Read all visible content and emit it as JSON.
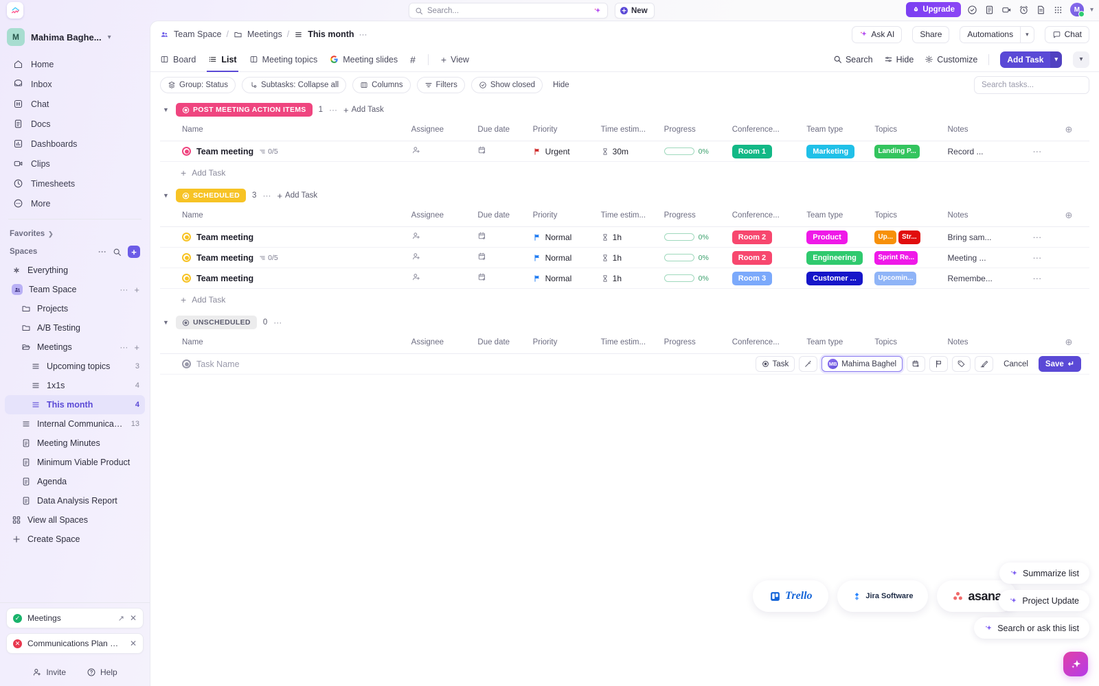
{
  "topbar": {
    "search_placeholder": "Search...",
    "new_label": "New",
    "upgrade_label": "Upgrade",
    "icons": [
      "check-circle-icon",
      "clipboard-icon",
      "video-clip-icon",
      "alarm-clock-icon",
      "doc-icon",
      "apps-grid-icon"
    ],
    "avatar_initial": "M"
  },
  "sidebar": {
    "workspace": {
      "initial": "M",
      "name": "Mahima Baghe..."
    },
    "nav": [
      {
        "label": "Home",
        "icon": "home-icon"
      },
      {
        "label": "Inbox",
        "icon": "inbox-icon"
      },
      {
        "label": "Chat",
        "icon": "chat-icon"
      },
      {
        "label": "Docs",
        "icon": "docs-icon"
      },
      {
        "label": "Dashboards",
        "icon": "dashboards-icon"
      },
      {
        "label": "Clips",
        "icon": "clips-icon"
      },
      {
        "label": "Timesheets",
        "icon": "timesheets-icon"
      },
      {
        "label": "More",
        "icon": "more-icon"
      }
    ],
    "favorites_label": "Favorites",
    "spaces_label": "Spaces",
    "tree": [
      {
        "label": "Everything",
        "count": "",
        "icon": "everything-icon",
        "indent": 0
      },
      {
        "label": "Team Space",
        "count": "",
        "icon": "team-space-icon",
        "indent": 0,
        "dots": true,
        "plus": true
      },
      {
        "label": "Projects",
        "count": "",
        "icon": "folder-icon",
        "indent": 1
      },
      {
        "label": "A/B Testing",
        "count": "",
        "icon": "folder-icon",
        "indent": 1
      },
      {
        "label": "Meetings",
        "count": "",
        "icon": "folder-open-icon",
        "indent": 1,
        "dots": true,
        "plus": true
      },
      {
        "label": "Upcoming topics",
        "count": "3",
        "icon": "list-icon",
        "indent": 2
      },
      {
        "label": "1x1s",
        "count": "4",
        "icon": "list-icon",
        "indent": 2
      },
      {
        "label": "This month",
        "count": "4",
        "icon": "list-icon",
        "indent": 2,
        "active": true
      },
      {
        "label": "Internal Communicati...",
        "count": "13",
        "icon": "list-icon",
        "indent": 1
      },
      {
        "label": "Meeting Minutes",
        "count": "",
        "icon": "doc-icon",
        "indent": 1
      },
      {
        "label": "Minimum Viable Product",
        "count": "",
        "icon": "doc-icon",
        "indent": 1
      },
      {
        "label": "Agenda",
        "count": "",
        "icon": "doc-icon",
        "indent": 1
      },
      {
        "label": "Data Analysis Report",
        "count": "",
        "icon": "doc-icon",
        "indent": 1
      },
      {
        "label": "View all Spaces",
        "count": "",
        "icon": "grid-icon",
        "indent": 0
      },
      {
        "label": "Create Space",
        "count": "",
        "icon": "plus-icon",
        "indent": 0
      }
    ],
    "notifications": [
      {
        "label": "Meetings",
        "status": "success"
      },
      {
        "label": "Communications Plan Wh...",
        "status": "error"
      }
    ],
    "footer": {
      "invite": "Invite",
      "help": "Help"
    }
  },
  "breadcrumb": {
    "space": "Team Space",
    "folder": "Meetings",
    "list": "This month",
    "actions": [
      "Ask AI",
      "Share",
      "Automations",
      "Chat"
    ]
  },
  "viewbar": {
    "tabs": [
      {
        "label": "Board",
        "icon": "board-icon",
        "active": false
      },
      {
        "label": "List",
        "icon": "list-icon",
        "active": true
      },
      {
        "label": "Meeting topics",
        "icon": "board-icon",
        "active": false
      },
      {
        "label": "Meeting slides",
        "icon": "google-icon",
        "active": false
      },
      {
        "label": "#",
        "icon": "hash-icon",
        "active": false
      }
    ],
    "add_view": "View",
    "right": [
      "Search",
      "Hide",
      "Customize"
    ],
    "add_task": "Add Task"
  },
  "filterbar": {
    "chips": [
      "Group: Status",
      "Subtasks: Collapse all",
      "Columns",
      "Filters",
      "Show closed"
    ],
    "hide_label": "Hide",
    "search_placeholder": "Search tasks..."
  },
  "columns": [
    "Name",
    "Assignee",
    "Due date",
    "Priority",
    "Time estim...",
    "Progress",
    "Conference...",
    "Team type",
    "Topics",
    "Notes"
  ],
  "groups": [
    {
      "name": "POST MEETING ACTION ITEMS",
      "color": "#ef457f",
      "count": "1",
      "add_task": "Add Task",
      "rows": [
        {
          "name": "Team meeting",
          "subtasks": "0/5",
          "status_color": "#ef457f",
          "priority": "Urgent",
          "priority_color": "#cf2b2b",
          "time": "30m",
          "progress": "0%",
          "conference": {
            "label": "Room 1",
            "color": "#12b886"
          },
          "team": {
            "label": "Marketing",
            "color": "#20c0e8"
          },
          "topics": [
            {
              "label": "Landing P...",
              "color": "#33c45e"
            }
          ],
          "notes": "Record ..."
        }
      ]
    },
    {
      "name": "SCHEDULED",
      "color": "#f7c325",
      "count": "3",
      "add_task": "Add Task",
      "rows": [
        {
          "name": "Team meeting",
          "subtasks": "",
          "status_color": "#f7c325",
          "priority": "Normal",
          "priority_color": "#1f7bf2",
          "time": "1h",
          "progress": "0%",
          "conference": {
            "label": "Room 2",
            "color": "#f7476e"
          },
          "team": {
            "label": "Product",
            "color": "#ef19e8"
          },
          "topics": [
            {
              "label": "Up...",
              "color": "#f79009"
            },
            {
              "label": "Str...",
              "color": "#e10d0d"
            }
          ],
          "notes": "Bring sam..."
        },
        {
          "name": "Team meeting",
          "subtasks": "0/5",
          "status_color": "#f7c325",
          "priority": "Normal",
          "priority_color": "#1f7bf2",
          "time": "1h",
          "progress": "0%",
          "conference": {
            "label": "Room 2",
            "color": "#f7476e"
          },
          "team": {
            "label": "Engineering",
            "color": "#2fc96e"
          },
          "topics": [
            {
              "label": "Sprint Re...",
              "color": "#ef19e8"
            }
          ],
          "notes": "Meeting ..."
        },
        {
          "name": "Team meeting",
          "subtasks": "",
          "status_color": "#f7c325",
          "priority": "Normal",
          "priority_color": "#1f7bf2",
          "time": "1h",
          "progress": "0%",
          "conference": {
            "label": "Room 3",
            "color": "#7ba9fb"
          },
          "team": {
            "label": "Customer ...",
            "color": "#1616c9"
          },
          "topics": [
            {
              "label": "Upcomin...",
              "color": "#8fb4f7"
            }
          ],
          "notes": "Remembe..."
        }
      ]
    },
    {
      "name": "UNSCHEDULED",
      "color": "#8a8a9b",
      "badge_bg": "#ececed",
      "badge_text": "#5b5b6e",
      "count": "0",
      "rows": []
    }
  ],
  "create_row": {
    "name_placeholder": "Task Name",
    "type_label": "Task",
    "assignee": "Mahima Baghel",
    "assignee_initials": "MB",
    "cancel_label": "Cancel",
    "save_label": "Save",
    "icons": [
      "magic-wand-icon",
      "due-date-icon",
      "flag-icon",
      "tag-icon",
      "edit-icon"
    ]
  },
  "integrations": [
    {
      "name": "Trello"
    },
    {
      "name": "Jira Software"
    },
    {
      "name": "asana"
    }
  ],
  "ai_suggestions": [
    "Summarize list",
    "Project Update",
    "Search or ask this list"
  ]
}
